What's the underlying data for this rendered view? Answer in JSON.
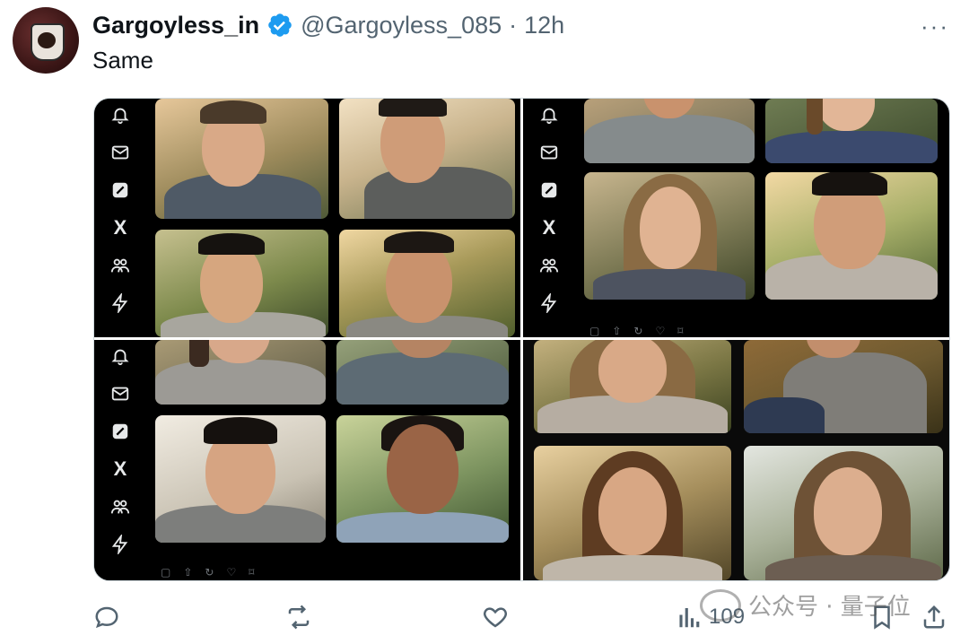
{
  "tweet": {
    "display_name": "Gargoyless_in",
    "handle": "@Gargoyless_085",
    "separator": "·",
    "time": "12h",
    "text": "Same",
    "more_label": "···"
  },
  "media": {
    "rail_icons": [
      "bell-icon",
      "mail-icon",
      "compose-icon",
      "x-logo-icon",
      "communities-icon",
      "lightning-icon"
    ],
    "x_glyph": "X"
  },
  "actions": {
    "views": "109"
  },
  "watermark": {
    "text": "公众号 · 量子位"
  },
  "colors": {
    "verified": "#1d9bf0",
    "text_primary": "#0f1419",
    "text_secondary": "#536471"
  }
}
